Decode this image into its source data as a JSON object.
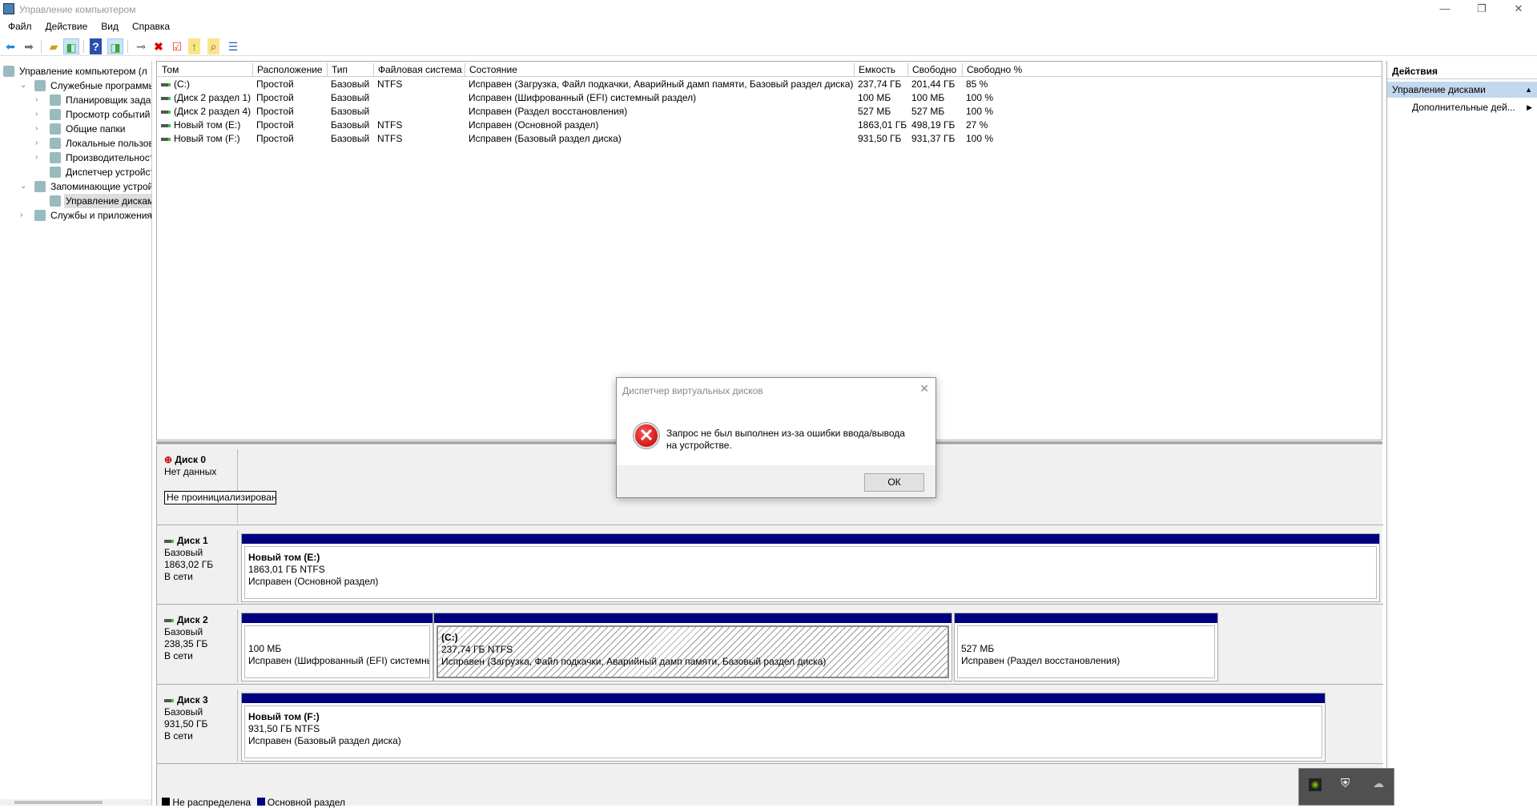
{
  "window": {
    "title": "Управление компьютером",
    "minimize": "—",
    "restore": "❐",
    "close": "✕"
  },
  "menu": [
    "Файл",
    "Действие",
    "Вид",
    "Справка"
  ],
  "toolbar": [
    "back-icon",
    "forward-icon",
    "up-folder-icon",
    "show-hide-tree-icon",
    "help-icon",
    "show-hide-action-pane-icon",
    "connect-icon",
    "delete-icon",
    "properties-icon",
    "export-icon",
    "search-icon",
    "checklist-icon"
  ],
  "tree": [
    {
      "label": "Управление компьютером (л",
      "level": 0,
      "expand": "",
      "icon": "computer-icon"
    },
    {
      "label": "Служебные программы",
      "level": 1,
      "expand": "⌄",
      "icon": "tools-icon"
    },
    {
      "label": "Планировщик заданий",
      "level": 2,
      "expand": "›",
      "icon": "clock-icon"
    },
    {
      "label": "Просмотр событий",
      "level": 2,
      "expand": "›",
      "icon": "event-log-icon"
    },
    {
      "label": "Общие папки",
      "level": 2,
      "expand": "›",
      "icon": "shared-folder-icon"
    },
    {
      "label": "Локальные пользовате",
      "level": 2,
      "expand": "›",
      "icon": "users-icon"
    },
    {
      "label": "Производительность",
      "level": 2,
      "expand": "›",
      "icon": "performance-icon"
    },
    {
      "label": "Диспетчер устройств",
      "level": 2,
      "expand": "",
      "icon": "device-manager-icon"
    },
    {
      "label": "Запоминающие устройст",
      "level": 1,
      "expand": "⌄",
      "icon": "storage-icon"
    },
    {
      "label": "Управление дисками",
      "level": 2,
      "expand": "",
      "icon": "disk-icon",
      "selected": true
    },
    {
      "label": "Службы и приложения",
      "level": 1,
      "expand": "›",
      "icon": "services-icon"
    }
  ],
  "volumes": {
    "columns": [
      "Том",
      "Расположение",
      "Тип",
      "Файловая система",
      "Состояние",
      "Емкость",
      "Свободно",
      "Свободно %"
    ],
    "rows": [
      [
        "(C:)",
        "Простой",
        "Базовый",
        "NTFS",
        "Исправен (Загрузка, Файл подкачки, Аварийный дамп памяти, Базовый раздел диска)",
        "237,74 ГБ",
        "201,44 ГБ",
        "85 %"
      ],
      [
        "(Диск 2 раздел 1)",
        "Простой",
        "Базовый",
        "",
        "Исправен (Шифрованный (EFI) системный раздел)",
        "100 МБ",
        "100 МБ",
        "100 %"
      ],
      [
        "(Диск 2 раздел 4)",
        "Простой",
        "Базовый",
        "",
        "Исправен (Раздел восстановления)",
        "527 МБ",
        "527 МБ",
        "100 %"
      ],
      [
        "Новый том (E:)",
        "Простой",
        "Базовый",
        "NTFS",
        "Исправен (Основной раздел)",
        "1863,01 ГБ",
        "498,19 ГБ",
        "27 %"
      ],
      [
        "Новый том (F:)",
        "Простой",
        "Базовый",
        "NTFS",
        "Исправен (Базовый раздел диска)",
        "931,50 ГБ",
        "931,37 ГБ",
        "100 %"
      ]
    ]
  },
  "disks": [
    {
      "name": "Диск 0",
      "line1": "Нет данных",
      "status": "Не проинициализирован"
    },
    {
      "name": "Диск 1",
      "type": "Базовый",
      "size": "1863,02 ГБ",
      "state": "В сети",
      "partitions": [
        {
          "title": "Новый том  (E:)",
          "size": "1863,01 ГБ NTFS",
          "status": "Исправен (Основной раздел)"
        }
      ]
    },
    {
      "name": "Диск 2",
      "type": "Базовый",
      "size": "238,35 ГБ",
      "state": "В сети",
      "partitions": [
        {
          "title": "",
          "size": "100 МБ",
          "status": "Исправен (Шифрованный (EFI) системный раздел)"
        },
        {
          "title": "(C:)",
          "size": "237,74 ГБ NTFS",
          "status": "Исправен (Загрузка, Файл подкачки, Аварийный дамп памяти, Базовый раздел диска)"
        },
        {
          "title": "",
          "size": "527 МБ",
          "status": "Исправен (Раздел восстановления)"
        }
      ]
    },
    {
      "name": "Диск 3",
      "type": "Базовый",
      "size": "931,50 ГБ",
      "state": "В сети",
      "partitions": [
        {
          "title": "Новый том  (F:)",
          "size": "931,50 ГБ NTFS",
          "status": "Исправен (Базовый раздел диска)"
        }
      ]
    }
  ],
  "legend": [
    {
      "label": "Не распределена",
      "color": "#000000"
    },
    {
      "label": "Основной раздел",
      "color": "#000080"
    }
  ],
  "actions": {
    "header": "Действия",
    "section": "Управление дисками",
    "item": "Дополнительные дей..."
  },
  "dialog": {
    "title": "Диспетчер виртуальных дисков",
    "message": "Запрос не был выполнен из-за ошибки ввода/вывода на устройстве.",
    "ok": "ОК"
  },
  "tray": [
    "nvidia-icon",
    "windows-security-warning-icon",
    "onedrive-offline-icon"
  ]
}
